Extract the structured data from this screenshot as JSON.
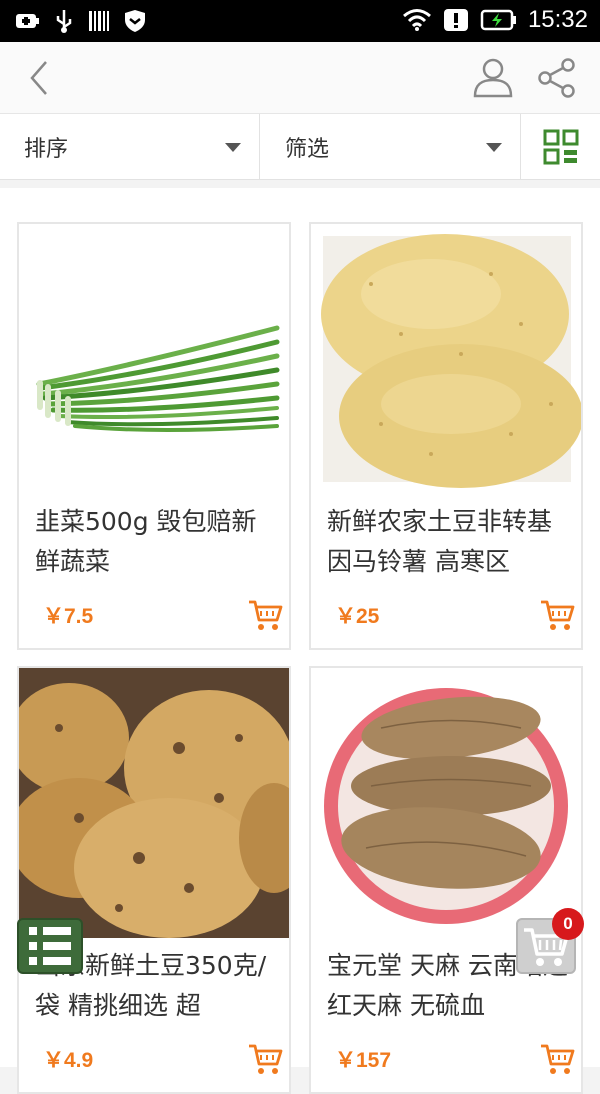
{
  "status_bar": {
    "time": "15:32"
  },
  "filter_bar": {
    "sort_label": "排序",
    "filter_label": "筛选"
  },
  "products": [
    {
      "title": "韭菜500g 毁包赔新鲜蔬菜",
      "price": "￥7.5"
    },
    {
      "title": "新鲜农家土豆非转基因马铃薯 高寒区",
      "price": "￥25"
    },
    {
      "title": "山东新鲜土豆350克/袋 精挑细选 超",
      "price": "￥4.9"
    },
    {
      "title": "宝元堂 天麻 云南昭通红天麻 无硫血",
      "price": "￥157"
    }
  ],
  "cart": {
    "count": "0"
  },
  "colors": {
    "accent": "#f07a1e",
    "brand_green": "#3e8a2e",
    "badge": "#d7191c"
  }
}
